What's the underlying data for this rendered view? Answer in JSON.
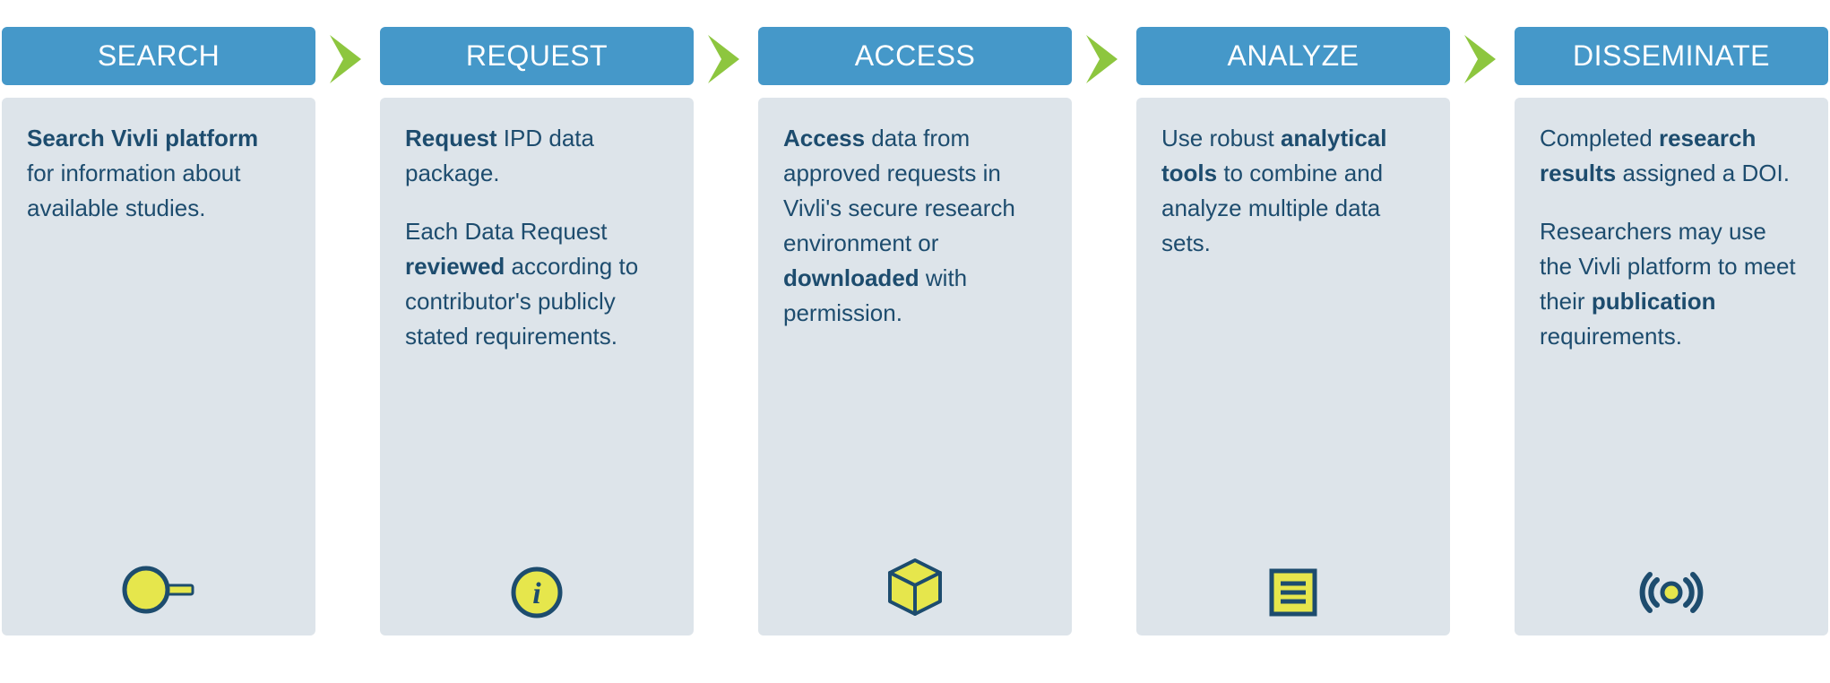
{
  "steps": [
    {
      "label": "SEARCH",
      "paragraphs": [
        [
          {
            "t": "Search Vivli platform",
            "b": true
          },
          {
            "t": " for information about available studies.",
            "b": false
          }
        ]
      ],
      "icon": "magnifier-icon"
    },
    {
      "label": "REQUEST",
      "paragraphs": [
        [
          {
            "t": "Request",
            "b": true
          },
          {
            "t": " IPD data package.",
            "b": false
          }
        ],
        [
          {
            "t": "Each Data Request ",
            "b": false
          },
          {
            "t": "reviewed",
            "b": true
          },
          {
            "t": " according to contributor's publicly stated requirements.",
            "b": false
          }
        ]
      ],
      "icon": "info-icon"
    },
    {
      "label": "ACCESS",
      "paragraphs": [
        [
          {
            "t": "Access",
            "b": true
          },
          {
            "t": " data from approved requests in Vivli's secure research environment or ",
            "b": false
          },
          {
            "t": "downloaded",
            "b": true
          },
          {
            "t": " with permission.",
            "b": false
          }
        ]
      ],
      "icon": "cube-icon"
    },
    {
      "label": "ANALYZE",
      "paragraphs": [
        [
          {
            "t": "Use robust ",
            "b": false
          },
          {
            "t": "analytical tools",
            "b": true
          },
          {
            "t": " to combine and analyze multiple data sets.",
            "b": false
          }
        ]
      ],
      "icon": "list-icon"
    },
    {
      "label": "DISSEMINATE",
      "paragraphs": [
        [
          {
            "t": "Completed ",
            "b": false
          },
          {
            "t": "research results",
            "b": true
          },
          {
            "t": " assigned a DOI.",
            "b": false
          }
        ],
        [
          {
            "t": "Researchers may use the Vivli platform to meet their ",
            "b": false
          },
          {
            "t": "publication",
            "b": true
          },
          {
            "t": " requirements.",
            "b": false
          }
        ]
      ],
      "icon": "broadcast-icon"
    }
  ]
}
